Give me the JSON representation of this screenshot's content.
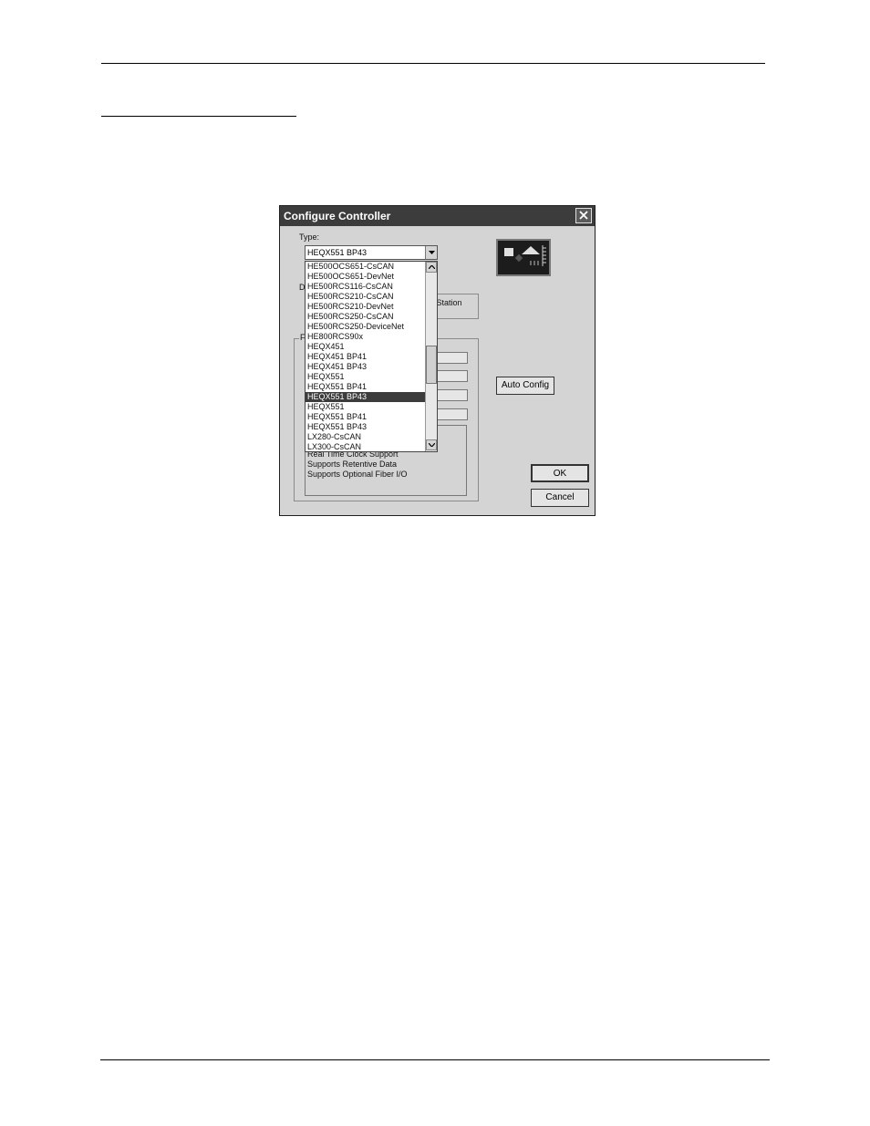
{
  "dialog": {
    "title": "Configure Controller",
    "type_label": "Type:",
    "selected_type": "HEQX551 BP43",
    "options": [
      "HE500OCS651-CsCAN",
      "HE500OCS651-DevNet",
      "HE500RCS116-CsCAN",
      "HE500RCS210-CsCAN",
      "HE500RCS210-DevNet",
      "HE500RCS250-CsCAN",
      "HE500RCS250-DeviceNet",
      "HE800RCS90x",
      "HEQX451",
      "HEQX451 BP41",
      "HEQX451 BP43",
      "HEQX551",
      "HEQX551 BP41",
      "HEQX551 BP43",
      "HEQX551",
      "HEQX551 BP41",
      "HEQX551 BP43",
      "LX280-CsCAN",
      "LX300-CsCAN"
    ],
    "selected_index": 13,
    "partial_label_d": "D",
    "partial_label_f": "F",
    "control_station_text": "rol Station",
    "partial_field_text": "s",
    "features": [
      "Real Time Clock Support",
      "Supports Retentive Data",
      "Supports Optional Fiber I/O"
    ],
    "auto_config_label": "Auto Config",
    "ok_label": "OK",
    "cancel_label": "Cancel"
  }
}
